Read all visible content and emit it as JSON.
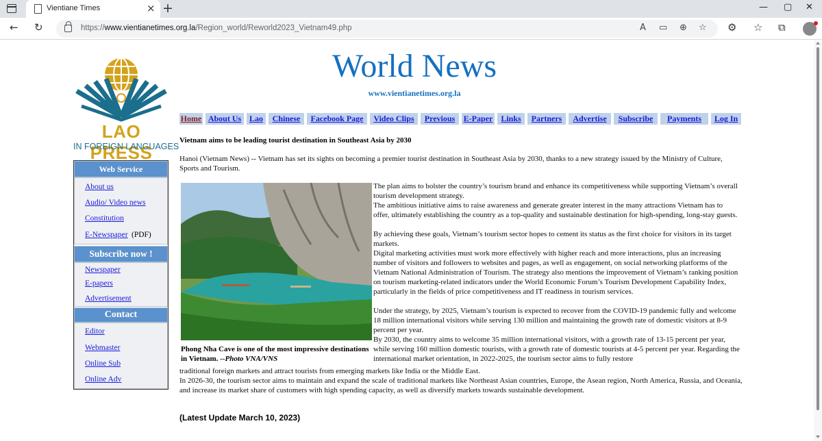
{
  "browser": {
    "tab_title": "Vientiane Times",
    "url_prefix": "https://",
    "url_domain": "www.vientianetimes.org.la",
    "url_path": "/Region_world/Reworld2023_Vietnam49.php"
  },
  "logo": {
    "line1": "LAO PRESS",
    "line2": "IN FOREIGN LANGUAGES"
  },
  "header": {
    "title": "World News",
    "url": "www.vientianetimes.org.la"
  },
  "nav": [
    "Home",
    "About Us",
    "Lao",
    "Chinese",
    "Facebook Page",
    "Video Clips",
    "Previous",
    "E-Paper",
    "Links",
    "Partners",
    "Advertise",
    "Subscribe",
    "Payments",
    "Log In"
  ],
  "sidebar": {
    "web_service": {
      "title": "Web Service",
      "items": [
        "About us",
        "Audio/ Video news",
        "Constitution",
        "E-Newspaper"
      ],
      "pdf_suffix": "(PDF)"
    },
    "subscribe": {
      "title": "Subscribe now !",
      "items": [
        "Newspaper",
        "E-papers",
        "Advertisement"
      ]
    },
    "contact": {
      "title": "Contact",
      "items": [
        "Editor",
        "Webmaster",
        "Online Sub",
        "Online Adv"
      ]
    }
  },
  "article": {
    "headline": "Vietnam aims to be leading tourist destination in Southeast Asia by 2030",
    "lead": "Hanoi (Vietnam News) -- Vietnam has set its sights on becoming a premier tourist destination in Southeast Asia by 2030, thanks to a new strategy issued by the Ministry of Culture, Sports and Tourism.",
    "caption_main": "Phong Nha Cave is one of the most impressive destinations in Vietnam. --",
    "caption_credit": "Photo VNA/VNS",
    "paragraphs_right": [
      "The plan aims to bolster the country’s tourism brand and enhance its competitiveness while supporting Vietnam’s overall tourism development strategy.",
      "The ambitious initiative aims to raise awareness and generate greater interest in the many attractions Vietnam has to offer, ultimately establishing the country as a top-quality and sustainable destination for high-spending, long-stay guests.",
      "By achieving these goals, Vietnam’s tourism sector hopes to cement its status as the first choice for visitors in its target markets.",
      "Digital marketing activities must work more effectively with higher reach and more interactions, plus an increasing number of visitors and followers to websites and pages, as well as engagement, on social networking platforms of the Vietnam National Administration of Tourism. The strategy also mentions the improvement of Vietnam’s ranking position on tourism marketing-related indicators under the World Economic Forum’s Tourism Development Capability Index, particularly in the fields of price competitiveness and IT readiness in tourism services.",
      "Under the strategy, by 2025, Vietnam’s tourism is expected to recover from the COVID-19 pandemic fully and welcome 18 million international visitors while serving 130 million and maintaining the growth rate of domestic visitors at 8-9 percent per year.",
      "By 2030, the country aims to welcome 35 million international visitors, with a growth rate of 13-15 percent per year, while serving 160 million domestic tourists, with a growth rate of domestic tourists at 4-5 percent per year. Regarding the international market orientation, in 2022-2025, the tourism sector aims to fully restore"
    ],
    "paragraph_wrap": "traditional foreign markets and attract tourists from emerging markets like India or the Middle East.",
    "paragraph_last": "In 2026-30, the tourism sector aims to maintain and expand the scale of traditional markets like Northeast Asian countries, Europe, the Asean region, North America, Russia, and Oceania, and increase its market share of customers with high spending capacity, as well as diversify markets towards sustainable development.",
    "update": "(Latest Update March 10, 2023)"
  }
}
